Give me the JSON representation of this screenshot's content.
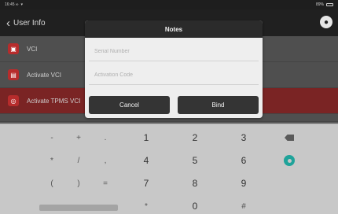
{
  "status_bar": {
    "time": "16:45 ∞",
    "signal": "▾",
    "battery_percent": "89%"
  },
  "header": {
    "title": "User Info",
    "back_glyph": "‹",
    "home_glyph": "●"
  },
  "menu": {
    "items": [
      {
        "label": "VCI",
        "icon": "lock-icon",
        "glyph": "▣"
      },
      {
        "label": "Activate VCI",
        "icon": "vci-icon",
        "glyph": "▤"
      },
      {
        "label": "Activate TPMS VCI",
        "icon": "tpms-icon",
        "glyph": "◎"
      },
      {
        "label": "",
        "icon": "",
        "glyph": ""
      }
    ]
  },
  "dialog": {
    "title": "Notes",
    "serial_placeholder": "Serial Number",
    "activation_placeholder": "Activation Code",
    "cancel_label": "Cancel",
    "bind_label": "Bind"
  },
  "keyboard": {
    "row1": [
      "-",
      "+",
      ".",
      "1",
      "2",
      "3"
    ],
    "row2": [
      "*",
      "/",
      ",",
      "4",
      "5",
      "6"
    ],
    "row3": [
      "(",
      ")",
      "=",
      "7",
      "8",
      "9"
    ],
    "row4": [
      "*",
      "0",
      "#"
    ],
    "backspace_icon": "backspace-icon",
    "go_icon": "go-icon"
  },
  "colors": {
    "accent": "#1fa39a",
    "active_row": "#7a2424",
    "icon_red": "#b72c2c"
  }
}
